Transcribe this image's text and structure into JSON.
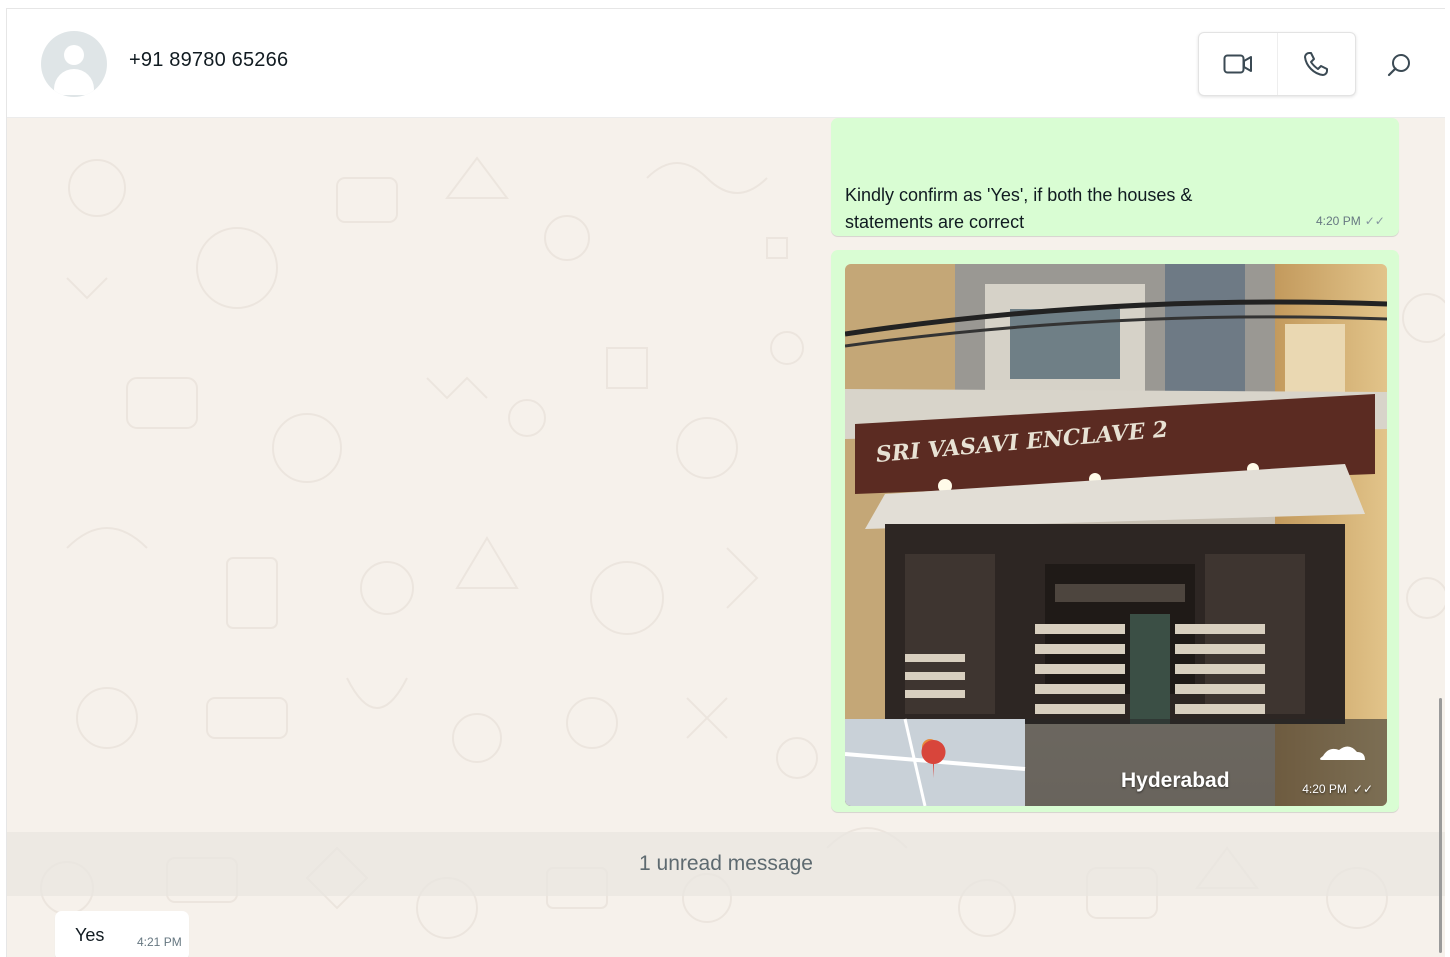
{
  "header": {
    "contact_name": "+91 89780 65266"
  },
  "icons": {
    "video_call": "video-camera-icon",
    "voice_call": "phone-icon",
    "search": "search-icon",
    "avatar": "default-avatar-icon"
  },
  "messages": {
    "outgoing_text": {
      "text": "Kindly confirm as 'Yes', if both the houses & statements are correct",
      "time": "4:20 PM"
    },
    "outgoing_photo": {
      "sign_text": "SRI VASAVI ENCLAVE 2",
      "location_label": "Hyderabad",
      "time": "4:20 PM"
    },
    "unread_divider": "1 unread message",
    "incoming": {
      "text": "Yes",
      "time": "4:21 PM"
    }
  },
  "colors": {
    "outgoing_bubble": "#d9fdd3",
    "incoming_bubble": "#ffffff",
    "chat_background": "#f6f1eb"
  }
}
